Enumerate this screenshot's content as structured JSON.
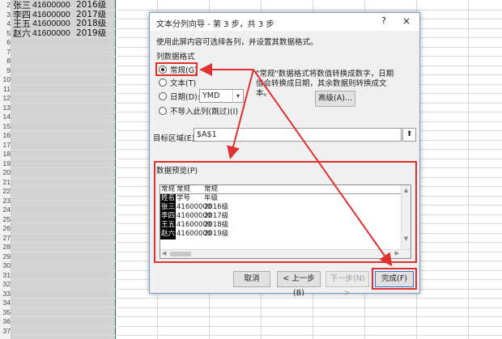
{
  "sheet": {
    "row_numbers": [
      "2",
      "3",
      "4",
      "5",
      "6",
      "7",
      "8",
      "9",
      "10",
      "11",
      "12",
      "13",
      "14",
      "15",
      "16",
      "17",
      "18",
      "19",
      "20",
      "21",
      "22",
      "23",
      "24",
      "25",
      "26",
      "27",
      "28",
      "29",
      "30",
      "31",
      "32",
      "33",
      "34",
      "35",
      "36",
      "37"
    ],
    "rows": [
      {
        "name": "张三",
        "id": "41600000",
        "year": "2016级"
      },
      {
        "name": "李四",
        "id": "41600000",
        "year": "2017级"
      },
      {
        "name": "王五",
        "id": "41600000",
        "year": "2018级"
      },
      {
        "name": "赵六",
        "id": "41600000",
        "year": "2019级"
      }
    ],
    "selection_color": "#217346"
  },
  "dialog": {
    "title": "文本分列向导 - 第 3 步，共 3 步",
    "help": "?",
    "close": "×",
    "instruction": "使用此屏内容可选择各列，并设置其数据格式。",
    "format_group": "列数据格式",
    "options": {
      "general": "常规(G)",
      "text": "文本(T)",
      "date": "日期(D):",
      "skip": "不导入此列(跳过)(I)"
    },
    "selected_option": "general",
    "date_format": "YMD",
    "description": "\"常规\"数据格式将数值转换成数字，日期值会转换成日期，其余数据则转换成文本。",
    "advanced_button": "高级(A)...",
    "destination_label": "目标区域(E):",
    "destination_value": "$A$1",
    "preview_label": "数据预览(P)",
    "preview": {
      "headers": [
        "常规",
        "常规",
        "常规"
      ],
      "rows": [
        [
          "姓名",
          "学号",
          "年级"
        ],
        [
          "张三",
          "41600000",
          "2016级"
        ],
        [
          "李四",
          "41600000",
          "2017级"
        ],
        [
          "王五",
          "41600000",
          "2018级"
        ],
        [
          "赵六",
          "41600000",
          "2019级"
        ]
      ]
    },
    "buttons": {
      "cancel": "取消",
      "back": "< 上一步(B)",
      "next": "下一步(N) >",
      "finish": "完成(F)"
    }
  },
  "annotation_color": "#e03030"
}
